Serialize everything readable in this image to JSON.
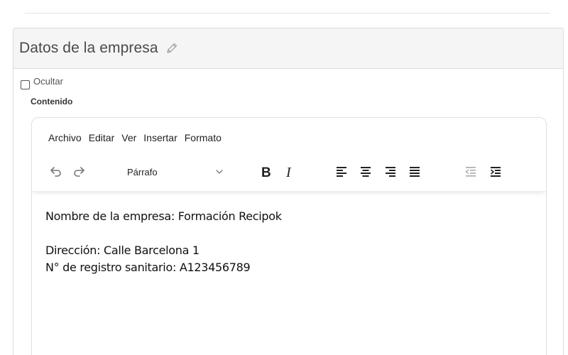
{
  "section": {
    "title": "Datos de la empresa",
    "edit_icon": "pencil-icon"
  },
  "hide_checkbox": {
    "label": "Ocultar",
    "checked": false
  },
  "content_label": "Contenido",
  "editor": {
    "menu": [
      "Archivo",
      "Editar",
      "Ver",
      "Insertar",
      "Formato"
    ],
    "block_format": "Párrafo",
    "toolbar_icons": [
      "undo-icon",
      "redo-icon",
      "chevron-down-icon",
      "bold-icon",
      "italic-icon",
      "align-left-icon",
      "align-center-icon",
      "align-right-icon",
      "align-justify-icon",
      "outdent-icon",
      "indent-icon"
    ],
    "body_lines": [
      "Nombre de la empresa: Formación Recipok",
      "",
      "Dirección: Calle Barcelona 1",
      "N° de registro sanitario: A123456789"
    ]
  }
}
